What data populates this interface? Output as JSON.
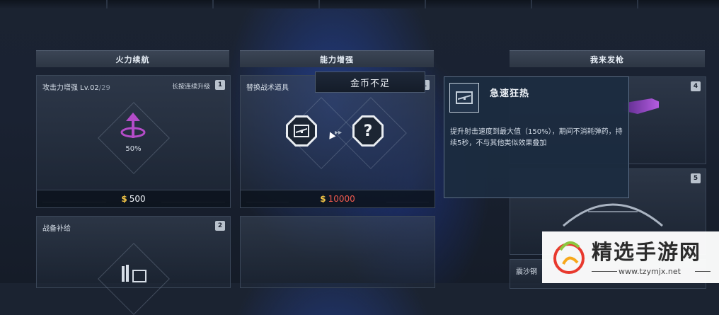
{
  "columns": {
    "firepower": {
      "header": "火力续航"
    },
    "ability": {
      "header": "能力增强"
    },
    "weapon": {
      "header": "我来发枪"
    }
  },
  "cards": {
    "attack": {
      "title": "攻击力增强 Lv.02",
      "title_suffix": "/29",
      "hint": "长按连续升级",
      "number": "1",
      "percent": "50%",
      "coin_symbol": "$",
      "price": "500",
      "icon": "arrow-up-ring-icon",
      "icon_color": "#b44cc8"
    },
    "tactical": {
      "title": "替换战术道具",
      "number": "1",
      "unknown_label": "?",
      "coin_symbol": "$",
      "price": "10000",
      "price_color": "#f05a4e"
    },
    "supply": {
      "title": "战备补给",
      "number": "2"
    },
    "weapon1": {
      "number": "4"
    },
    "weapon2": {
      "number": "5"
    },
    "weapon3": {
      "title": "震沙钢"
    }
  },
  "toast": {
    "text": "金币不足"
  },
  "tooltip": {
    "name": "急速狂热",
    "description": "提升射击速度到最大值（150%），期间不消耗弹药，持续5秒，不与其他类似效果叠加"
  },
  "watermark": {
    "brand": "精选手游网",
    "url": "www.tzymjx.net"
  }
}
